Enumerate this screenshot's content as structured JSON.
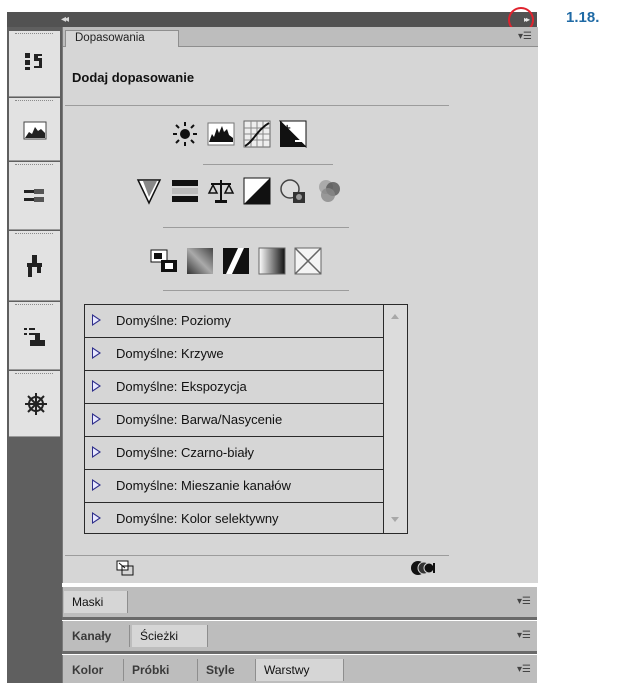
{
  "step_label": "1.18.",
  "topbar": {
    "collapse_glyph": "◂◂",
    "expand_glyph": "▸▸"
  },
  "dock": {
    "buttons": [
      "adjustments-icon",
      "histogram-icon",
      "brush-presets-icon",
      "clone-source-icon",
      "tool-presets-icon",
      "navigator-icon"
    ]
  },
  "panel": {
    "tab_label": "Dopasowania",
    "title": "Dodaj dopasowanie",
    "icon_rows": [
      [
        "brightness-contrast-icon",
        "levels-icon",
        "curves-icon",
        "exposure-icon"
      ],
      [
        "vibrance-icon",
        "hue-saturation-icon",
        "color-balance-icon",
        "black-white-icon",
        "photo-filter-icon",
        "channel-mixer-icon"
      ],
      [
        "invert-icon",
        "posterize-icon",
        "threshold-icon",
        "gradient-map-icon",
        "selective-color-icon"
      ]
    ],
    "presets": [
      "Domyślne: Poziomy",
      "Domyślne: Krzywe",
      "Domyślne: Ekspozycja",
      "Domyślne: Barwa/Nasycenie",
      "Domyślne: Czarno-biały",
      "Domyślne: Mieszanie kanałów",
      "Domyślne: Kolor selektywny"
    ]
  },
  "groups": {
    "masks": {
      "tabs": [
        "Maski"
      ]
    },
    "channels": {
      "tabs": [
        "Kanały",
        "Ścieżki"
      ]
    },
    "layers": {
      "tabs": [
        "Kolor",
        "Próbki",
        "Style",
        "Warstwy"
      ]
    }
  },
  "colors": {
    "accent": "#1f6aa5",
    "highlight_circle": "#e0232e",
    "panel_bg": "#d6d6d6",
    "dock_bg": "#5f5f5f"
  }
}
